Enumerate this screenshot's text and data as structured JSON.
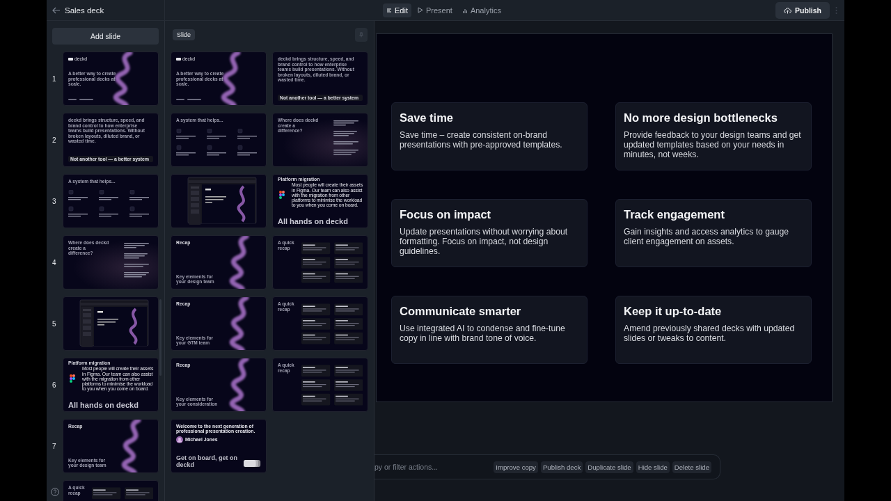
{
  "window": {
    "title": "Sales deck"
  },
  "tabs": [
    {
      "label": "Edit",
      "selected": true
    },
    {
      "label": "Present",
      "selected": false
    },
    {
      "label": "Analytics",
      "selected": false
    }
  ],
  "publish_button": {
    "label": "Publish"
  },
  "add_slide_button": {
    "label": "Add slide"
  },
  "slides": [
    {
      "number": "1",
      "thumb": {
        "kind": "title",
        "logo": "deckd",
        "headline": "A better **way to create professional decks at scale.**"
      }
    },
    {
      "number": "2",
      "thumb": {
        "kind": "statement",
        "headline": "deckd brings **structure, speed, and brand control** to how enterprise teams build presentations. **Without broken layouts, diluted brand, or wasted time.**",
        "footer": "Not another tool — a better system"
      }
    },
    {
      "number": "3",
      "thumb": {
        "kind": "system",
        "headline": "A system that **helps...**"
      }
    },
    {
      "number": "4",
      "thumb": {
        "kind": "difference",
        "headline": "Where **does deckd** create a difference?"
      }
    },
    {
      "number": "5",
      "thumb": {
        "kind": "app"
      }
    },
    {
      "number": "6",
      "thumb": {
        "kind": "platform",
        "label": "Platform migration",
        "body": "Most people will create their assets in Figma. Our team can also assist with the migration from other platforms to minimise the workload to you when you come on board.",
        "headline": "All hands on **deckd**"
      }
    },
    {
      "number": "7",
      "thumb": {
        "kind": "key",
        "label": "Recap",
        "headline": "Key elements for your **design team**"
      }
    },
    {
      "thumb": {
        "kind": "recap",
        "headline": "A quick recap"
      }
    }
  ],
  "template_panel": {
    "chip": "Slide",
    "templates": [
      {
        "kind": "title",
        "logo": "deckd",
        "headline": "A better **way to create professional decks at scale.**"
      },
      {
        "kind": "statement",
        "headline": "deckd brings **structure, speed, and brand control** to how enterprise teams build presentations. **Without broken layouts, diluted brand, or wasted time.**",
        "footer": "Not another tool — a better system"
      },
      {
        "kind": "system",
        "headline": "A system that **helps...**"
      },
      {
        "kind": "difference",
        "headline": "Where **does deckd** create a difference?"
      },
      {
        "kind": "app"
      },
      {
        "kind": "platform",
        "label": "Platform migration",
        "body": "Most people will create their assets in Figma. Our team can also assist with the migration from other platforms to minimise the workload to you when you come on board.",
        "headline": "All hands on **deckd**"
      },
      {
        "kind": "key",
        "label": "Recap",
        "headline": "Key elements for your **design team**"
      },
      {
        "kind": "recap",
        "headline": "A quick recap"
      },
      {
        "kind": "key",
        "label": "Recap",
        "headline": "Key elements for your **GTM team**"
      },
      {
        "kind": "recap",
        "headline": "A quick recap"
      },
      {
        "kind": "key",
        "label": "Recap",
        "headline": "Key elements for your **consideration**"
      },
      {
        "kind": "recap",
        "headline": "A quick recap"
      },
      {
        "kind": "welcome",
        "intro": "Welcome to the next generation of professional presentation creation.",
        "name": "Michael Jones",
        "headline": "Get on board, get on **deckd**"
      }
    ]
  },
  "canvas": {
    "cards": [
      {
        "title": "Save time",
        "body": "Save time – create consistent on-brand presentations with pre-approved templates."
      },
      {
        "title": "No more design bottlenecks",
        "body": "Provide feedback to your design teams and get updated templates based on your needs in minutes, not weeks."
      },
      {
        "title": "Focus on impact",
        "body": "Update presentations without worrying about formatting. Focus on impact, not design guidelines."
      },
      {
        "title": "Track engagement",
        "body": "Gain insights and access analytics to gauge client engagement on assets."
      },
      {
        "title": "Communicate smarter",
        "body": "Use integrated AI to condense and fine-tune copy in line with brand tone of voice."
      },
      {
        "title": "Keep it up-to-date",
        "body": "Amend previously shared decks with updated slides or tweaks to content."
      }
    ]
  },
  "command_bar": {
    "placeholder": "py or filter actions...",
    "actions": [
      "Improve copy",
      "Publish deck",
      "Duplicate slide",
      "Hide slide",
      "Delete slide"
    ]
  }
}
